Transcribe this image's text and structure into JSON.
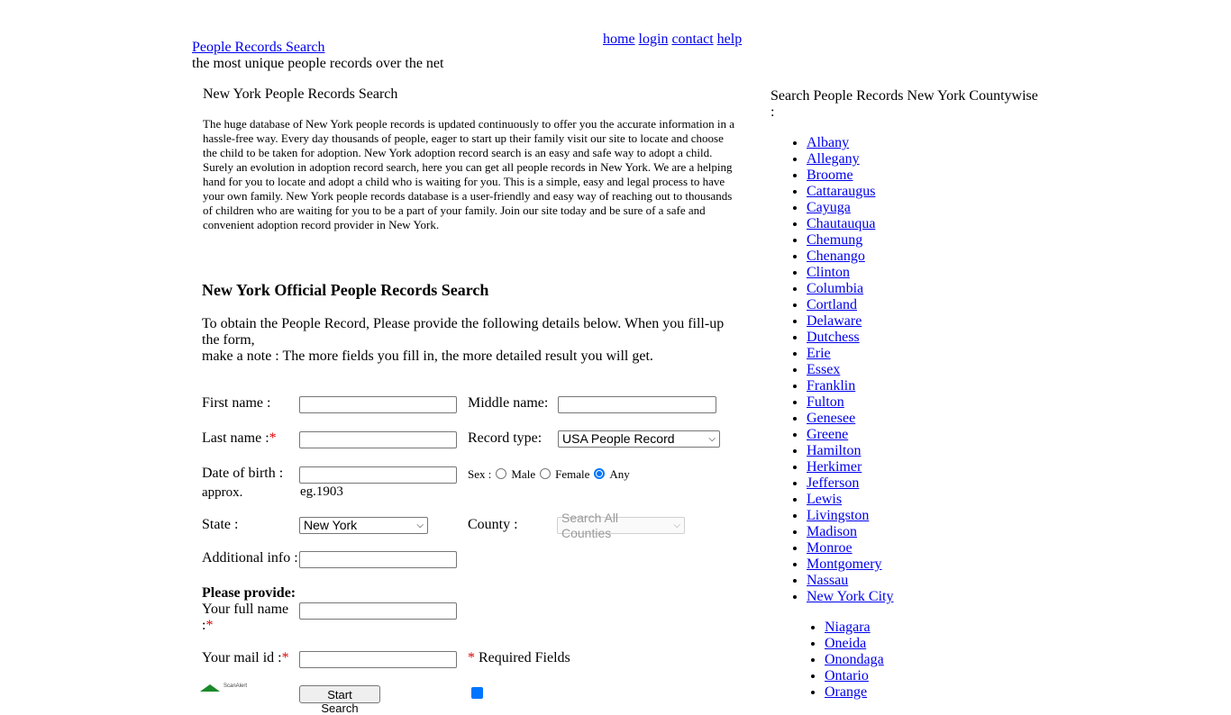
{
  "header": {
    "site_title": "People Records Search",
    "tagline": "the most unique people records over the net",
    "nav": [
      "home",
      "login",
      "contact",
      "help"
    ]
  },
  "intro": {
    "title": "New York People Records Search",
    "text": "The huge database of New York people records is updated continuously to offer you the accurate information in a hassle-free way. Every day thousands of people, eager to start up their family visit our site to locate and choose the child to be taken for adoption. New York adoption record search is an easy and safe way to adopt a child. Surely an evolution in adoption record search, here you can get all people records in New York. We are a helping hand for you to locate and adopt a child who is waiting for you. This is a simple, easy and legal process to have your own family. New York people records database is a user-friendly and easy way of reaching out to thousands of children who are waiting for you to be a part of your family. Join our site today and be sure of a safe and convenient adoption record provider in New York."
  },
  "form": {
    "title": "New York Official People Records Search",
    "instructions_line1": "To obtain the People Record, Please provide the following details below. When you fill-up the form,",
    "instructions_line2": "make a note : The more fields you fill in, the more detailed result you will get.",
    "first_name_label": "First name :",
    "first_name_value": "",
    "middle_name_label": "Middle name:",
    "middle_name_value": "",
    "last_name_label": "Last name :",
    "last_name_value": "",
    "record_type_label": "Record type:",
    "record_type_value": "USA People Record",
    "dob_label": "Date of birth :",
    "dob_sublabel": "approx.",
    "dob_value": "",
    "dob_hint": "eg.1903",
    "sex_label": "Sex :",
    "sex_options": [
      "Male",
      "Female",
      "Any"
    ],
    "sex_selected": "Any",
    "state_label": "State :",
    "state_value": "New York",
    "county_label": "County :",
    "county_value": "Search All Counties",
    "additional_info_label": "Additional info :",
    "additional_info_value": "",
    "please_provide_label": "Please provide:",
    "full_name_label": "Your full name",
    "full_name_label_suffix": ":",
    "full_name_value": "",
    "mail_label": "Your mail id :",
    "mail_value": "",
    "required_note": "Required Fields",
    "required_marker": "*",
    "scan_logo_text": "ScanAlert",
    "submit_label": "Start Search",
    "checkbox_checked": true
  },
  "sidebar": {
    "heading": "Search People Records New York Countywise",
    "heading_suffix": ":",
    "counties": [
      "Albany",
      "Allegany",
      "Broome",
      "Cattaraugus",
      "Cayuga",
      "Chautauqua",
      "Chemung",
      "Chenango",
      "Clinton",
      "Columbia",
      "Cortland",
      "Delaware",
      "Dutchess",
      "Erie",
      "Essex",
      "Franklin",
      "Fulton",
      "Genesee",
      "Greene",
      "Hamilton",
      "Herkimer",
      "Jefferson",
      "Lewis",
      "Livingston",
      "Madison",
      "Monroe",
      "Montgomery",
      "Nassau",
      "New York City"
    ],
    "counties_nested": [
      "Niagara",
      "Oneida",
      "Onondaga",
      "Ontario",
      "Orange"
    ]
  }
}
